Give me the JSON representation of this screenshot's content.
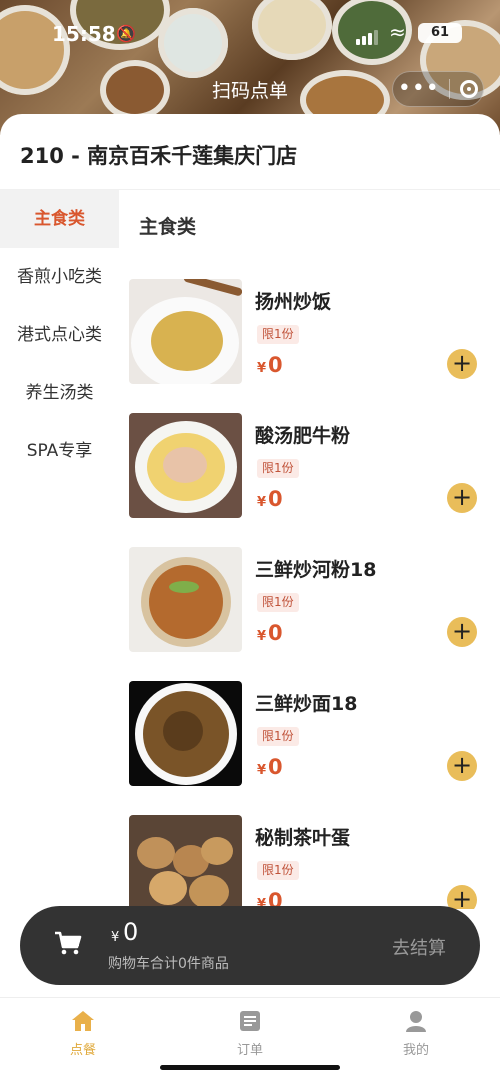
{
  "status_bar": {
    "time": "15:58",
    "battery": "61"
  },
  "nav": {
    "title": "扫码点单",
    "more_icon": "more-dots-icon",
    "close_icon": "target-circle-icon"
  },
  "store": {
    "name": "210 - 南京百禾千莲集庆门店"
  },
  "categories": [
    {
      "label": "主食类",
      "active": true
    },
    {
      "label": "香煎小吃类",
      "active": false
    },
    {
      "label": "港式点心类",
      "active": false
    },
    {
      "label": "养生汤类",
      "active": false
    },
    {
      "label": "SPA专享",
      "active": false
    }
  ],
  "section": {
    "title": "主食类"
  },
  "items": [
    {
      "name": "扬州炒饭",
      "badge": "限1份",
      "currency": "¥",
      "price": "0"
    },
    {
      "name": "酸汤肥牛粉",
      "badge": "限1份",
      "currency": "¥",
      "price": "0"
    },
    {
      "name": "三鲜炒河粉18",
      "badge": "限1份",
      "currency": "¥",
      "price": "0"
    },
    {
      "name": "三鲜炒面18",
      "badge": "限1份",
      "currency": "¥",
      "price": "0"
    },
    {
      "name": "秘制茶叶蛋",
      "badge": "限1份",
      "currency": "¥",
      "price": "0"
    }
  ],
  "cart": {
    "currency": "¥",
    "amount": "0",
    "summary": "购物车合计0件商品",
    "checkout_label": "去结算"
  },
  "tabs": [
    {
      "label": "点餐",
      "icon": "home-icon",
      "active": true
    },
    {
      "label": "订单",
      "icon": "order-list-icon",
      "active": false
    },
    {
      "label": "我的",
      "icon": "user-icon",
      "active": false
    }
  ],
  "colors": {
    "accent": "#d9572e",
    "add_button": "#e9bd5a",
    "cart_bar": "#333333",
    "tab_active": "#e0a93a"
  }
}
